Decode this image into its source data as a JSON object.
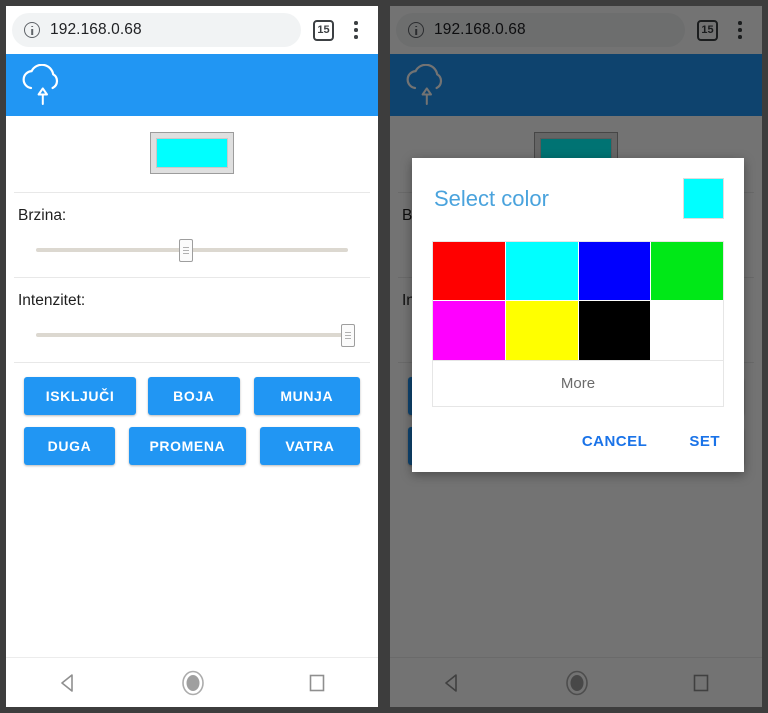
{
  "browser": {
    "url": "192.168.0.68",
    "info_icon": "info-circle-icon",
    "tab_count": "15",
    "menu_icon": "overflow-menu-icon"
  },
  "page": {
    "header_icon": "cloud-upload-icon",
    "header_color": "#2196f3",
    "current_color": "#00ffff",
    "sliders": [
      {
        "label": "Brzina:",
        "value": 48
      },
      {
        "label": "Intenzitet:",
        "value": 100
      }
    ],
    "buttons": [
      [
        "ISKLJUČI",
        "BOJA",
        "MUNJA"
      ],
      [
        "DUGA",
        "PROMENA",
        "VATRA"
      ]
    ]
  },
  "dialog": {
    "title": "Select color",
    "current_color": "#00ffff",
    "swatches": [
      [
        "#ff0000",
        "#00ffff",
        "#0000ff",
        "#00e817"
      ],
      [
        "#ff00ff",
        "#ffff00",
        "#000000",
        "#ffffff"
      ]
    ],
    "swatch_names": [
      [
        "swatch-red",
        "swatch-cyan",
        "swatch-blue",
        "swatch-green"
      ],
      [
        "swatch-magenta",
        "swatch-yellow",
        "swatch-black",
        "swatch-white"
      ]
    ],
    "more_label": "More",
    "cancel_label": "CANCEL",
    "set_label": "SET"
  },
  "navbar": {
    "back_icon": "nav-back-triangle-icon",
    "home_icon": "nav-home-circle-icon",
    "recent_icon": "nav-recents-square-icon"
  }
}
